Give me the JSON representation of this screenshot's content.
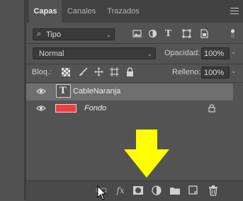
{
  "tabs": [
    {
      "label": "Capas",
      "active": true
    },
    {
      "label": "Canales",
      "active": false
    },
    {
      "label": "Trazados",
      "active": false
    }
  ],
  "filter": {
    "kind_label": "Tipo",
    "icons": [
      "image-filter-icon",
      "adjustment-filter-icon",
      "type-filter-icon",
      "shape-filter-icon",
      "smart-object-filter-icon",
      "filter-toggle-icon"
    ]
  },
  "blend": {
    "mode": "Normal",
    "opacity_label": "Opacidad:",
    "opacity_value": "100%"
  },
  "lock": {
    "label": "Bloq.:",
    "icons": [
      "lock-transparent-icon",
      "lock-brush-icon",
      "lock-move-icon",
      "lock-artboard-icon",
      "lock-all-icon"
    ],
    "fill_label": "Relleno:",
    "fill_value": "100%"
  },
  "layers": [
    {
      "name": "CableNaranja",
      "type": "text",
      "selected": true,
      "visible": true,
      "locked": false
    },
    {
      "name": "Fondo",
      "type": "fill",
      "color": "#ee4040",
      "selected": false,
      "visible": true,
      "locked": true,
      "italic": true
    }
  ],
  "bottom_icons": [
    "link-layers-icon",
    "layer-style-icon",
    "add-mask-icon",
    "adjustment-layer-icon",
    "new-group-icon",
    "new-layer-icon",
    "delete-layer-icon"
  ],
  "highlight": {
    "color": "#ffff00"
  }
}
